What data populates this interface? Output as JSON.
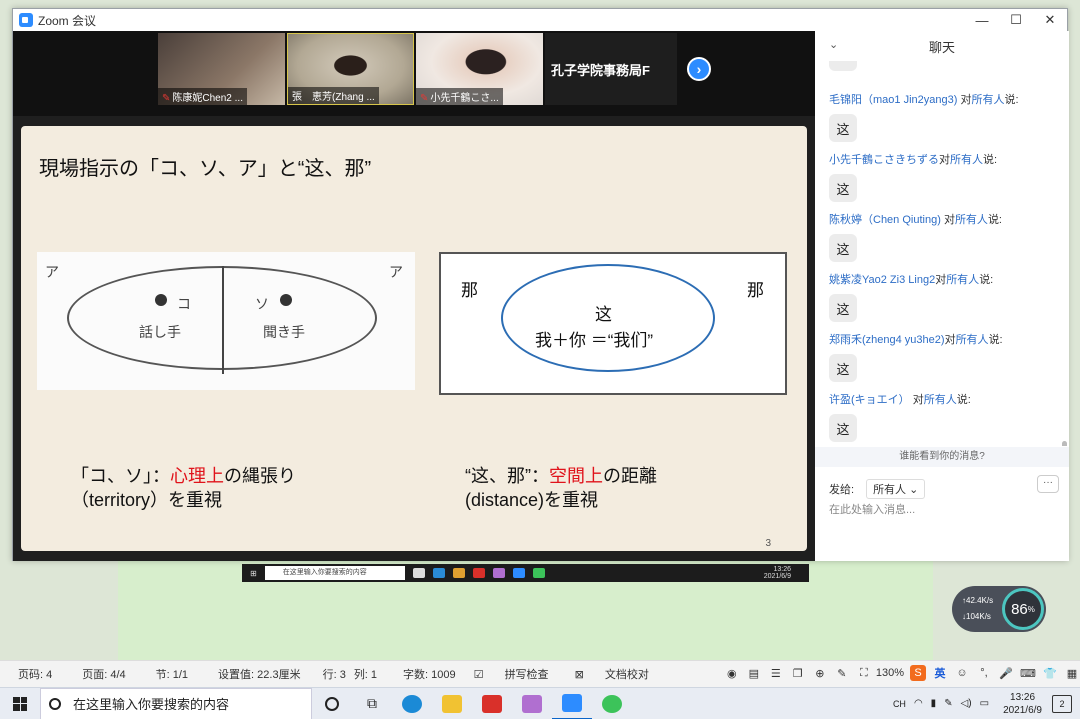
{
  "window": {
    "title": "Zoom 会议"
  },
  "participants": [
    {
      "name": "陈康妮Chen2 ..."
    },
    {
      "name": "張　恵芳(Zhang ..."
    },
    {
      "name": "小先千鶴こさ..."
    },
    {
      "name": "孔子学院事務局F"
    }
  ],
  "slide": {
    "title": "現場指示の「コ、ソ、ア」と“这、那”",
    "left_fig": {
      "a_left": "ア",
      "a_right": "ア",
      "ko": "コ",
      "so": "ソ",
      "speaker": "話し手",
      "listener": "聞き手"
    },
    "right_fig": {
      "na_left": "那",
      "na_right": "那",
      "zhe": "这",
      "formula": "我＋你 ＝“我们”"
    },
    "caption_left": {
      "prefix": "「コ、ソ」：",
      "highlight": "心理上",
      "suffix": "の縄張り",
      "line2": "（territory）を重視"
    },
    "caption_right": {
      "prefix": "“这、那”：",
      "highlight": "空間上",
      "suffix": "の距離",
      "line2": "(distance)を重視"
    },
    "page_number": "3"
  },
  "chat": {
    "header": "聊天",
    "to_word": "对",
    "group_word": "所有人",
    "say_word": "说:",
    "messages": [
      {
        "sender": "毛锦阳（mao1 Jin2yang3)",
        "text": "这"
      },
      {
        "sender": "小先千鶴こさきちずる",
        "text": "这"
      },
      {
        "sender": "陈秋婷（Chen Qiuting)",
        "text": "这"
      },
      {
        "sender": "姚紫凌Yao2 Zi3 Ling2",
        "text": "这"
      },
      {
        "sender": "郑雨禾(zheng4 yu3he2)",
        "text": "这"
      },
      {
        "sender": "许盈(キョエイ）",
        "text": "这"
      }
    ],
    "who_can_see": "谁能看到你的消息?",
    "send_to_label": "发给:",
    "send_to_value": "所有人",
    "input_placeholder": "在此处输入消息..."
  },
  "mini_taskbar": {
    "search": "在这里输入你要搜索的内容",
    "time": "13:26",
    "date": "2021/6/9"
  },
  "net_widget": {
    "up": "42.4",
    "down": "104",
    "unit": "K/s",
    "percent": "86"
  },
  "word_status": {
    "page": "页码: 4",
    "page_of": "页面: 4/4",
    "section": "节: 1/1",
    "setting": "设置值: 22.3厘米",
    "row": "行: 3",
    "col": "列: 1",
    "words": "字数: 1009",
    "spell": "拼写检查",
    "proof": "文档校对",
    "zoom": "130%",
    "ime": "英"
  },
  "taskbar": {
    "search": "在这里输入你要搜索的内容",
    "time": "13:26",
    "date": "2021/6/9",
    "lang": "CH",
    "notif": "2"
  },
  "colors": {
    "zoom_blue": "#2d8cff",
    "slide_bg": "#f3ecdf",
    "highlight_red": "#e0131b",
    "ellipse_blue": "#2c6db4"
  }
}
